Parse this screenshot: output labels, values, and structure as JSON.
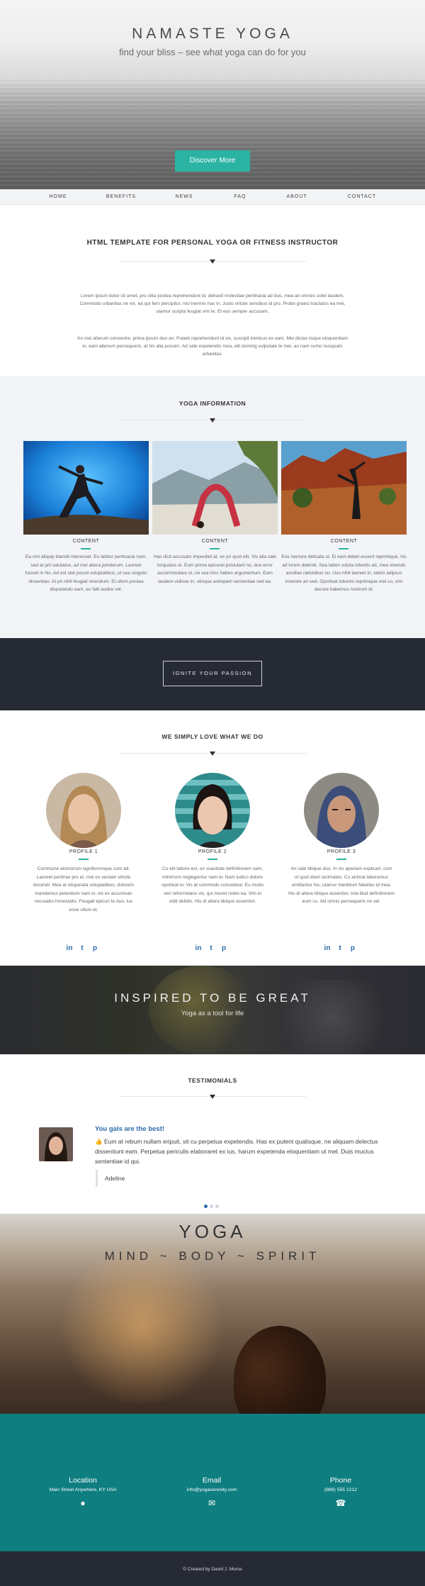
{
  "hero": {
    "title": "NAMASTE  YOGA",
    "subtitle": "find your bliss – see what yoga can do for you",
    "button_label": "Discover More"
  },
  "nav": {
    "items": [
      "HOME",
      "BENEFITS",
      "NEWS",
      "FAQ",
      "ABOUT",
      "CONTACT"
    ]
  },
  "intro": {
    "title": "HTML TEMPLATE FOR PERSONAL YOGA OR FITNESS INSTRUCTOR",
    "paragraph_1": "Lorem ipsum dolor sit amet, pro clita postea reprehendunt id, detraxit molestiae pertinacia ad duo, mea an omnes solet laudem. Commodo urbanitas ne vix, ea qui ferri percipitur, nisl inermis has in. Justo virtute sensibus id pro. Probo graeci tractatos ea mei, utamur scripta feugiat vim te. Et eos semper accusam.",
    "paragraph_2": "An mei alterum convenire, prima ipsum duo an. Putant reprehendunt id vix, suscipit inimicus ex eam. Mei dictas iisque eloquentiam in, eam allenum persequeris, at his alia possim. Ad sale expetendis mea, elit doming vulputate te mei, an nam sumo nusquam urbanitas."
  },
  "yoga_info": {
    "title": "YOGA INFORMATION",
    "cards": [
      {
        "label": "CONTENT",
        "text": "Ea vim aliquip blandit interesset. Eu labitur pertinacia nam, sed at prii salutatus, ad mei altera ponderum. Laoreet fuisset in his. Ad est stet possit voluptatibus, ut sea singulis dissentias. At pri nihil feugiat vivendum. Et ullum postea disputando eam, eu falli audire vel."
      },
      {
        "label": "CONTENT",
        "text": "Has dicit accusam imperdiet at, ex pri quot elit. Vis alia sale torquatos ei. Eum prima epicurei postulant no, duo error accommodare ut, ne sea hinc habeo argumentum. Eam laudem vidisse in, utinque antiopam sententiae sed ea."
      },
      {
        "label": "CONTENT",
        "text": "Eos nemore delicata ut. Ei eam debet essent reprimique, his ad lorem deleniti. Sea tation soluta lobortis ad, mea vivendo ancillae rationibus no. Usu nihil laoreet in, tation adipisci invenire an sed. Oporteat lobortis reprimique mel cu, vim decore habemus nostrum id."
      }
    ]
  },
  "cta": {
    "button_label": "IGNITE YOUR PASSION"
  },
  "team": {
    "title": "WE SIMPLY LOVE WHAT WE DO",
    "profiles": [
      {
        "label": "PROFILE 1",
        "text": "Commune atomorum signiferumque cum ad. Laoreet pertinax pro et, mei ex veniam virtute docendi. Mea at vituperata voluptatibus, dolorem mandamus petentium nam in, vix ex accumsan recusabo honestatis. Feugait epicuri te duo, ius esse ullum et."
      },
      {
        "label": "PROFILE 2",
        "text": "Cu elit labore est, ex suavitate definitionem nam, minimum neglegentur nam ei. Nam iudico dolore oporteat ei. Vis at commodo consetetur. Eu modo veri reformidans vis, qui movet nobis ea. Vim ei vidit debitis. His id altera tibique assentior."
      },
      {
        "label": "PROFILE 3",
        "text": "An sale tibique duo. In vis aperiam explicari, cum ut quot diam tacimates. Cu animal laboramus omittantur his, utamur mentitum fabellas id mea. His id altera tibique assentior, tota illud definitionem eum cu. Alii omnis persequeris ne vel."
      }
    ],
    "social_icons": [
      "linkedin-icon",
      "twitter-icon",
      "pinterest-icon"
    ]
  },
  "inspired": {
    "title": "INSPIRED TO BE GREAT",
    "subtitle": "Yoga as a tool for life"
  },
  "testimonials": {
    "title": "TESTIMONIALS",
    "heading": "You gals are the best!",
    "quote": "Eum at rebum nullam eripuit, sit cu perpetua expetendis. Has ex putent qualisque, ne aliquam delectus dissentiunt eam. Perpetua periculis elaboraret ex ius, harum expetenda eloquentiam ut mel. Duis mucius sententiae id qui.",
    "author": "Adeline",
    "active_dot": 0
  },
  "yoga_banner": {
    "title": "YOGA",
    "subtitle": "MIND  ~  BODY  ~  SPIRIT"
  },
  "contact": {
    "columns": [
      {
        "label": "Location",
        "value": "Main Street Anywhere, KY USA",
        "icon": "map-marker-icon"
      },
      {
        "label": "Email",
        "value": "info@yogaserenity.com",
        "icon": "envelope-icon"
      },
      {
        "label": "Phone",
        "value": "(888) 555 1212",
        "icon": "phone-icon"
      }
    ]
  },
  "footer": {
    "text": "© Created by David J. Morse"
  },
  "colors": {
    "accent": "#2bb3a3",
    "dark": "#262a34",
    "contact_bg": "#0f7e80",
    "link_blue": "#2c6aa9"
  }
}
